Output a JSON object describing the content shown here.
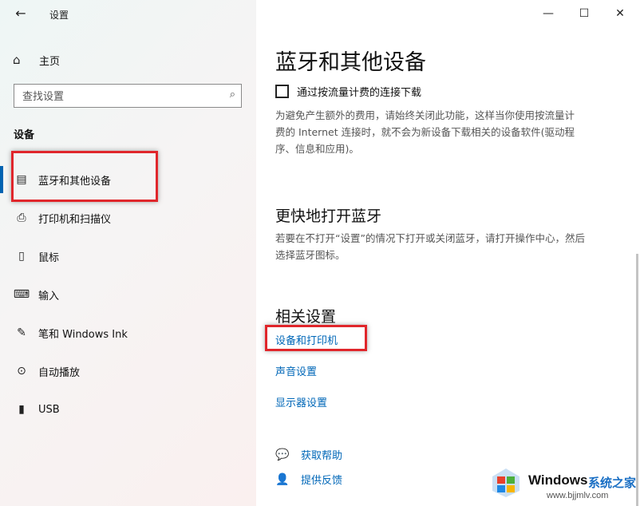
{
  "window": {
    "title": "设置",
    "back_icon": "←",
    "minimize_icon": "—",
    "maximize_icon": "☐",
    "close_icon": "✕"
  },
  "sidebar": {
    "home": {
      "label": "主页",
      "icon": "⌂"
    },
    "search": {
      "placeholder": "查找设置",
      "icon": "⌕"
    },
    "section_title": "设备",
    "items": [
      {
        "label": "蓝牙和其他设备",
        "icon": "bluetooth-devices-icon",
        "glyph": "▤",
        "active": true
      },
      {
        "label": "打印机和扫描仪",
        "icon": "printer-icon",
        "glyph": "⎙",
        "active": false
      },
      {
        "label": "鼠标",
        "icon": "mouse-icon",
        "glyph": "▯",
        "active": false
      },
      {
        "label": "输入",
        "icon": "keyboard-icon",
        "glyph": "⌨",
        "active": false
      },
      {
        "label": "笔和 Windows Ink",
        "icon": "pen-icon",
        "glyph": "✎",
        "active": false
      },
      {
        "label": "自动播放",
        "icon": "autoplay-icon",
        "glyph": "⊙",
        "active": false
      },
      {
        "label": "USB",
        "icon": "usb-icon",
        "glyph": "▮",
        "active": false
      }
    ]
  },
  "main": {
    "page_title": "蓝牙和其他设备",
    "metered_checkbox": {
      "label": "通过按流量计费的连接下载",
      "checked": false
    },
    "metered_desc": [
      "为避免产生额外的费用，请始终关闭此功能，这样当你使用按流量计",
      "费的 Internet 连接时，就不会为新设备下载相关的设备软件(驱动程",
      "序、信息和应用)。"
    ],
    "quick_bt_title": "更快地打开蓝牙",
    "quick_bt_desc": [
      "若要在不打开“设置”的情况下打开或关闭蓝牙，请打开操作中心，然后",
      "选择蓝牙图标。"
    ],
    "related_title": "相关设置",
    "related_links": [
      "设备和打印机",
      "声音设置",
      "显示器设置"
    ],
    "help": [
      {
        "label": "获取帮助",
        "glyph": "💬"
      },
      {
        "label": "提供反馈",
        "glyph": "👤"
      }
    ]
  },
  "watermark": {
    "brand": "Windows",
    "site": "系统之家",
    "url": "www.bjjmlv.com"
  },
  "colors": {
    "accent": "#0063b1",
    "link": "#0067b8",
    "highlight": "#e0262b"
  }
}
